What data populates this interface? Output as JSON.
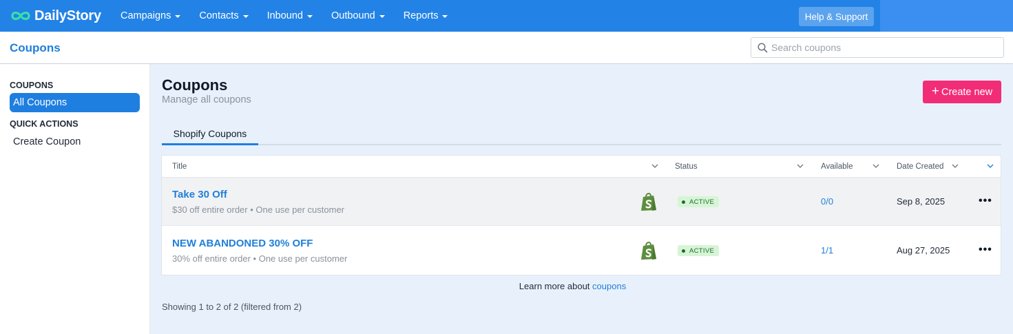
{
  "nav": {
    "brand": "DailyStory",
    "menu": [
      "Campaigns",
      "Contacts",
      "Inbound",
      "Outbound",
      "Reports"
    ],
    "help_label": "Help & Support"
  },
  "subheader": {
    "title": "Coupons",
    "search_placeholder": "Search coupons"
  },
  "sidebar": {
    "section1": "COUPONS",
    "active_item": "All Coupons",
    "section2": "QUICK ACTIONS",
    "action_item": "Create Coupon"
  },
  "main": {
    "title": "Coupons",
    "subtitle": "Manage all coupons",
    "create_label": "Create new",
    "tab": "Shopify Coupons",
    "columns": {
      "title": "Title",
      "status": "Status",
      "available": "Available",
      "date_created": "Date Created"
    },
    "rows": [
      {
        "title": "Take 30 Off",
        "desc": "$30 off entire order • One use per customer",
        "status": "ACTIVE",
        "available": "0/0",
        "date": "Sep 8, 2025"
      },
      {
        "title": "NEW ABANDONED 30% OFF",
        "desc": "30% off entire order • One use per customer",
        "status": "ACTIVE",
        "available": "1/1",
        "date": "Aug 27, 2025"
      }
    ],
    "learn_prefix": "Learn more about",
    "learn_link": "coupons",
    "showing": "Showing 1 to 2 of 2 (filtered from 2)"
  },
  "colors": {
    "nav_bg": "#2382e6",
    "accent": "#1f7fe0",
    "create_btn": "#f22d77",
    "active_badge": "#d6f5d6",
    "shopify_green": "#5e8e3e"
  },
  "icons": [
    "infinity-logo-icon",
    "search-icon",
    "chevron-down-icon",
    "shopify-icon",
    "more-icon",
    "plus-icon"
  ]
}
